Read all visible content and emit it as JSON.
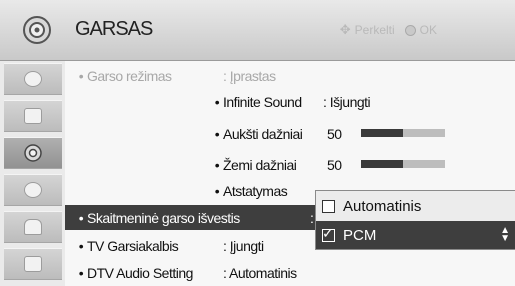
{
  "header": {
    "title": "GARSAS",
    "hint_label": "Perkelti",
    "ok_label": "OK",
    "icon": "speaker-icon"
  },
  "sidebar": {
    "tabs": [
      {
        "icon": "picture-icon"
      },
      {
        "icon": "screen-icon"
      },
      {
        "icon": "audio-icon",
        "active": true
      },
      {
        "icon": "clock-icon"
      },
      {
        "icon": "lock-icon"
      },
      {
        "icon": "option-icon"
      }
    ]
  },
  "menu": {
    "sound_mode": {
      "label": "Garso režimas",
      "value": ": Įprastas"
    },
    "infinite_sound": {
      "label": "Infinite Sound",
      "value": ": Išjungti"
    },
    "treble": {
      "label": "Aukšti dažniai",
      "value": "50",
      "level": 0.5
    },
    "bass": {
      "label": "Žemi dažniai",
      "value": "50",
      "level": 0.5
    },
    "reset": {
      "label": "Atstatymas"
    },
    "digital_out": {
      "label": "Skaitmeninė garso išvestis",
      "value": ":"
    },
    "tv_speaker": {
      "label": "TV Garsiakalbis",
      "value": ": Įjungti"
    },
    "dtv_audio": {
      "label": "DTV Audio Setting",
      "value": ": Automatinis"
    }
  },
  "dropdown": {
    "options": [
      {
        "label": "Automatinis",
        "checked": false
      },
      {
        "label": "PCM",
        "checked": true
      }
    ]
  },
  "colors": {
    "highlight": "#3e3e3e",
    "dim_text": "#a8a8a8"
  }
}
